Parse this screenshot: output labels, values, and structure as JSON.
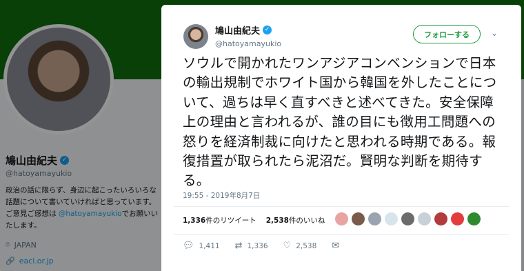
{
  "profile": {
    "name": "鳩山由紀夫",
    "handle": "@hatoyamayukio",
    "bio_pre": "政治の話に限らず、身辺に起こったいろいろな話題について書いていければと思っています。ご意見ご感想は ",
    "bio_link": "@hatoyamayukio",
    "bio_post": "でお願いいたします。",
    "location": "JAPAN",
    "url": "eaci.or.jp"
  },
  "tweet": {
    "author_name": "鳩山由紀夫",
    "author_handle": "@hatoyamayukio",
    "follow_label": "フォローする",
    "text": "ソウルで開かれたワンアジアコンベンションで日本の輸出規制でホワイト国から韓国を外したことについて、過ちは早く直すべきと述べてきた。安全保障上の理由と言われるが、誰の目にも徴用工問題への怒りを経済制裁に向けたと思われる時期である。報復措置が取られたら泥沼だ。賢明な判断を期待する。",
    "timestamp": "19:55 - 2019年8月7日",
    "retweets_count": "1,336",
    "retweets_label": "件のリツイート",
    "likes_count": "2,538",
    "likes_label": "件のいいね",
    "reply_count": "1,411",
    "retweet_count": "1,336",
    "like_count": "2,538"
  },
  "colors": {
    "banner": "#0f6e0f",
    "accent": "#1b9a3a",
    "verified": "#1da1f2"
  },
  "liker_avatars": [
    "#e8a3a3",
    "#7a5a4a",
    "#9aa4b0",
    "#d8e4ec",
    "#6b6b6b",
    "#c8d0d8",
    "#b33b3b",
    "#e23c3c",
    "#2f8a2f"
  ]
}
